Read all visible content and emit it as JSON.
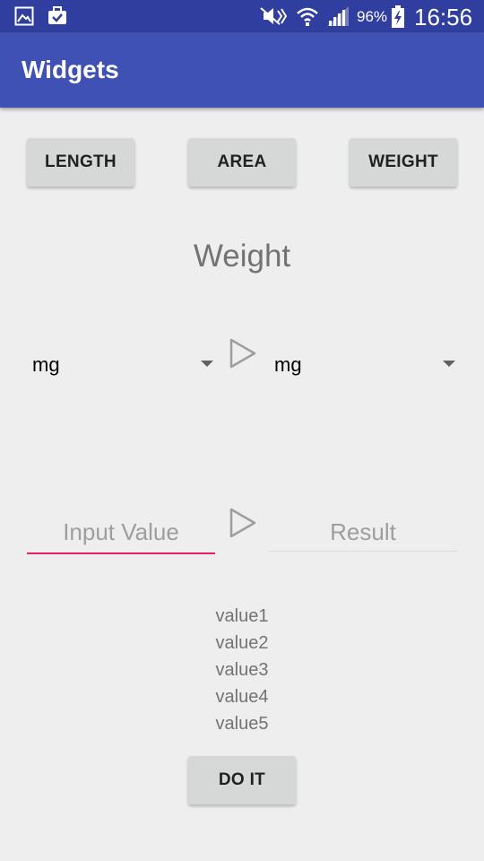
{
  "status_bar": {
    "battery_pct": "96%",
    "time": "16:56"
  },
  "app_bar": {
    "title": "Widgets"
  },
  "category_buttons": {
    "length": "LENGTH",
    "area": "AREA",
    "weight": "WEIGHT"
  },
  "section_title": "Weight",
  "from_unit": "mg",
  "to_unit": "mg",
  "input": {
    "placeholder": "Input Value",
    "value": ""
  },
  "result": {
    "placeholder": "Result"
  },
  "values": [
    "value1",
    "value2",
    "value3",
    "value4",
    "value5"
  ],
  "action_button": "DO IT",
  "colors": {
    "status_bar": "#303f9f",
    "app_bar": "#3f51b5",
    "accent": "#e91e63",
    "background": "#eeeeee",
    "button": "#d6d7d7"
  }
}
